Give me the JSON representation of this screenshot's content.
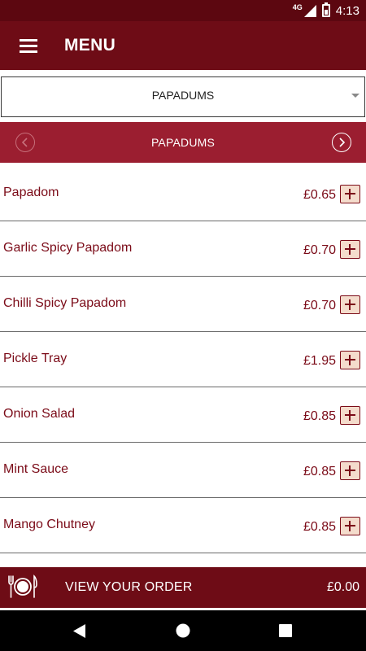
{
  "status_bar": {
    "network": "4G",
    "time": "4:13"
  },
  "app_bar": {
    "title": "MENU",
    "menu_icon": "hamburger-icon"
  },
  "category_dropdown": {
    "selected": "PAPADUMS"
  },
  "category_bar": {
    "title": "PAPADUMS",
    "prev_icon": "chevron-left-circle-icon",
    "next_icon": "chevron-right-circle-icon"
  },
  "items": [
    {
      "name": "Papadom",
      "price": "£0.65"
    },
    {
      "name": "Garlic Spicy Papadom",
      "price": "£0.70"
    },
    {
      "name": "Chilli Spicy Papadom",
      "price": "£0.70"
    },
    {
      "name": "Pickle Tray",
      "price": "£1.95"
    },
    {
      "name": "Onion Salad",
      "price": "£0.85"
    },
    {
      "name": "Mint Sauce",
      "price": "£0.85"
    },
    {
      "name": "Mango Chutney",
      "price": "£0.85"
    }
  ],
  "order_bar": {
    "label": "VIEW YOUR ORDER",
    "total": "£0.00",
    "icon": "plate-cutlery-icon"
  },
  "colors": {
    "status_bar": "#5c0710",
    "app_bar": "#6e0c16",
    "category_bar": "#9b1e30",
    "accent_text": "#7b0b18",
    "add_button_bg": "#f4dccc"
  }
}
